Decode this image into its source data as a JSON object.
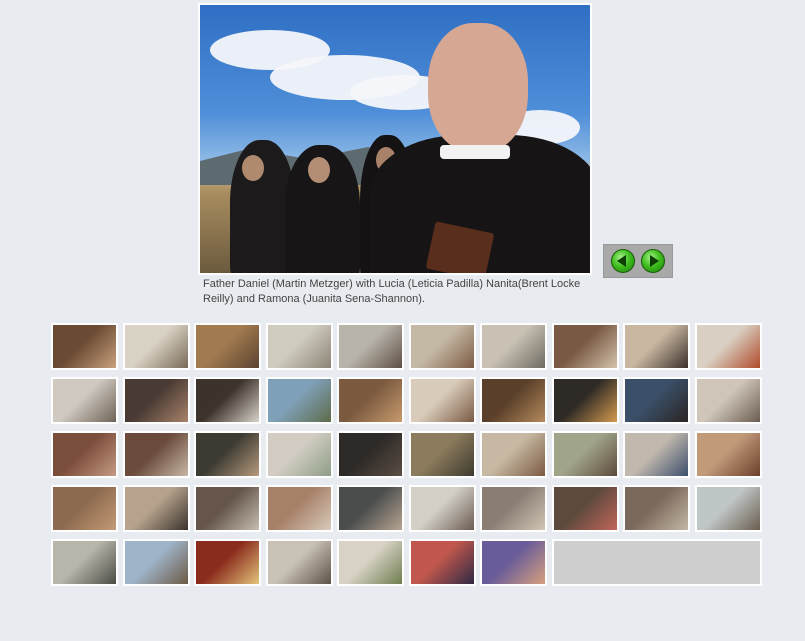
{
  "main_image": {
    "caption": "Father Daniel (Martin Metzger) with Lucia (Leticia Padilla) Nanita(Brent Locke Reilly) and Ramona (Juanita Sena-Shannon)."
  },
  "navigation": {
    "previous_icon": "green-left-arrow-icon",
    "next_icon": "green-right-arrow-icon"
  },
  "thumbnails": [
    {
      "colors": [
        "#6b4a33",
        "#c9a27e"
      ]
    },
    {
      "colors": [
        "#d8d2c4",
        "#7a6a58"
      ]
    },
    {
      "colors": [
        "#a27a4f",
        "#5b4332"
      ]
    },
    {
      "colors": [
        "#d0cbbf",
        "#8a8376"
      ]
    },
    {
      "colors": [
        "#b9b4aa",
        "#5e4f45"
      ]
    },
    {
      "colors": [
        "#c4b9a5",
        "#7d5b43"
      ]
    },
    {
      "colors": [
        "#c8c1b4",
        "#6f6a61"
      ]
    },
    {
      "colors": [
        "#7a5a45",
        "#d4c2aa"
      ]
    },
    {
      "colors": [
        "#c9b7a1",
        "#3b2f2a"
      ]
    },
    {
      "colors": [
        "#d9cfc2",
        "#b04a2a"
      ]
    },
    {
      "colors": [
        "#cfc9c0",
        "#6f6357"
      ]
    },
    {
      "colors": [
        "#4a3a34",
        "#a7846a"
      ]
    },
    {
      "colors": [
        "#3d332d",
        "#d8d2c8"
      ]
    },
    {
      "colors": [
        "#7fa0b9",
        "#5e6b4a"
      ]
    },
    {
      "colors": [
        "#7b5a3f",
        "#c79a6d"
      ]
    },
    {
      "colors": [
        "#d8cbb9",
        "#7a5a44"
      ]
    },
    {
      "colors": [
        "#5a3f2a",
        "#b58a5c"
      ]
    },
    {
      "colors": [
        "#2e2a26",
        "#d49a4d"
      ]
    },
    {
      "colors": [
        "#3a4f68",
        "#2b2523"
      ]
    },
    {
      "colors": [
        "#cfc6b9",
        "#6a5c50"
      ]
    },
    {
      "colors": [
        "#7b4d3b",
        "#c69a82"
      ]
    },
    {
      "colors": [
        "#6a4a3a",
        "#c8b8a6"
      ]
    },
    {
      "colors": [
        "#3c3b33",
        "#b79a7e"
      ]
    },
    {
      "colors": [
        "#d2ccc2",
        "#8d9d87"
      ]
    },
    {
      "colors": [
        "#2d2927",
        "#5b4e44"
      ]
    },
    {
      "colors": [
        "#8c7b5d",
        "#3d3a2e"
      ]
    },
    {
      "colors": [
        "#c6b8a2",
        "#7b5a43"
      ]
    },
    {
      "colors": [
        "#a0a58a",
        "#5d4a3b"
      ]
    },
    {
      "colors": [
        "#c2b9ae",
        "#3c506c"
      ]
    },
    {
      "colors": [
        "#c19a7a",
        "#6d3f2b"
      ]
    },
    {
      "colors": [
        "#8c6a4f",
        "#c39a75"
      ]
    },
    {
      "colors": [
        "#b7a38d",
        "#3a332e"
      ]
    },
    {
      "colors": [
        "#65554a",
        "#c7beb2"
      ]
    },
    {
      "colors": [
        "#a78068",
        "#d8cbbb"
      ]
    },
    {
      "colors": [
        "#4b4d4d",
        "#b7a591"
      ]
    },
    {
      "colors": [
        "#d4d0c6",
        "#6b5c52"
      ]
    },
    {
      "colors": [
        "#8a7d74",
        "#d2c6b6"
      ]
    },
    {
      "colors": [
        "#5d4a3c",
        "#c0655a"
      ]
    },
    {
      "colors": [
        "#7a6a5d",
        "#c5b7a4"
      ]
    },
    {
      "colors": [
        "#bfc6c6",
        "#6b5e4f"
      ]
    },
    {
      "colors": [
        "#b8b5aa",
        "#4a4d44"
      ]
    },
    {
      "colors": [
        "#9fb3c9",
        "#6b5a44"
      ]
    },
    {
      "colors": [
        "#8a2c1d",
        "#e4c37a"
      ]
    },
    {
      "colors": [
        "#c9c2b7",
        "#5e5248"
      ]
    },
    {
      "colors": [
        "#d8d2c6",
        "#6e7d4d"
      ]
    },
    {
      "colors": [
        "#c0564d",
        "#2e2a44"
      ]
    },
    {
      "colors": [
        "#6a5c9a",
        "#d6a07c"
      ]
    }
  ]
}
